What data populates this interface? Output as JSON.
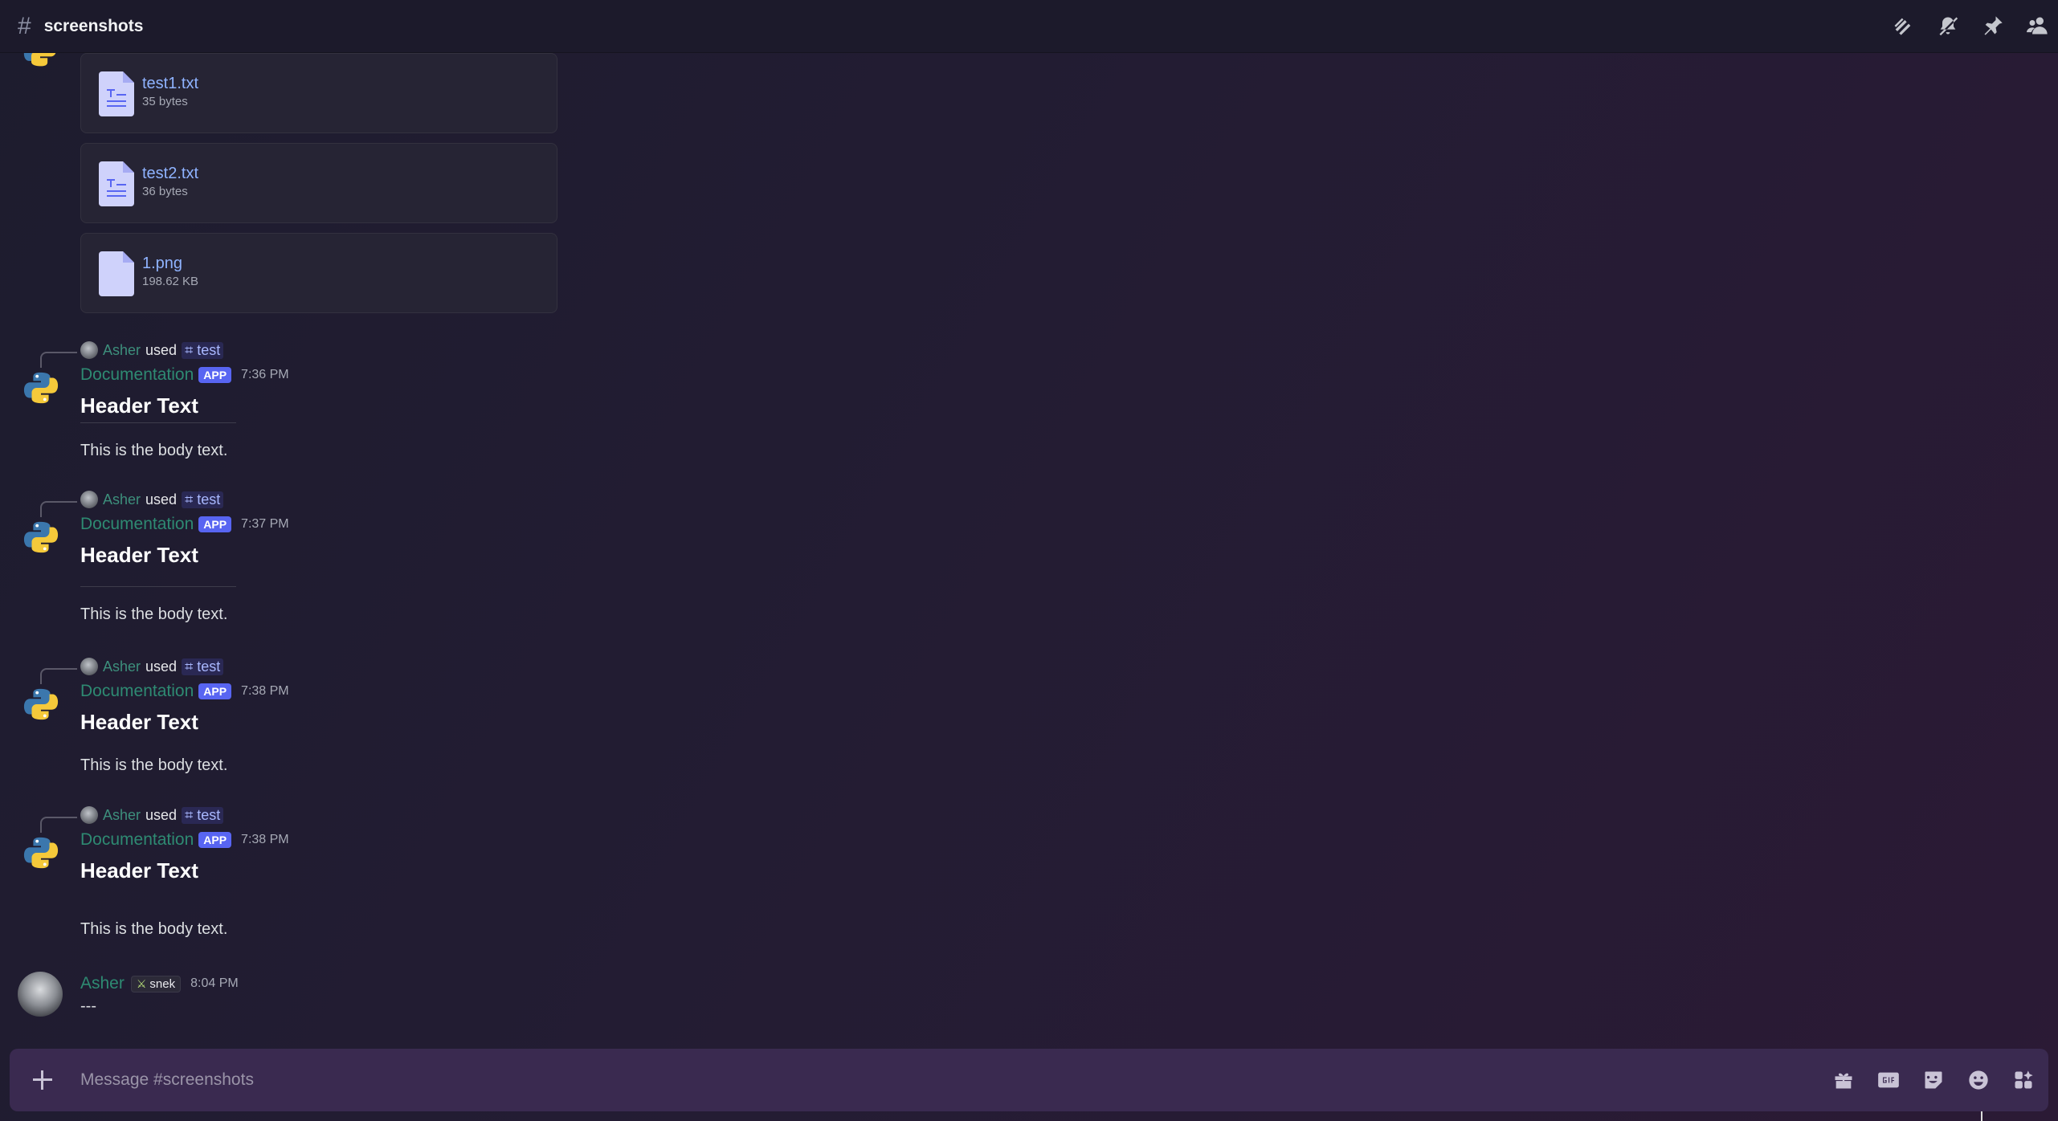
{
  "header": {
    "hash_symbol": "#",
    "channel_name": "screenshots"
  },
  "top_icons": [
    "threads-icon",
    "notification-mute-icon",
    "pin-icon",
    "members-icon"
  ],
  "attachments": [
    {
      "name": "test1.txt",
      "size": "35 bytes",
      "icon": "text-file-icon"
    },
    {
      "name": "test2.txt",
      "size": "36 bytes",
      "icon": "text-file-icon"
    },
    {
      "name": "1.png",
      "size": "198.62 KB",
      "icon": "file-icon"
    }
  ],
  "bot_messages": [
    {
      "reply_user": "Asher",
      "reply_used": "used",
      "command": "test",
      "bot_name": "Documentation",
      "badge": "APP",
      "time": "7:36 PM",
      "header": "Header Text",
      "body": "This is the body text."
    },
    {
      "reply_user": "Asher",
      "reply_used": "used",
      "command": "test",
      "bot_name": "Documentation",
      "badge": "APP",
      "time": "7:37 PM",
      "header": "Header Text",
      "body": "This is the body text."
    },
    {
      "reply_user": "Asher",
      "reply_used": "used",
      "command": "test",
      "bot_name": "Documentation",
      "badge": "APP",
      "time": "7:38 PM",
      "header": "Header Text",
      "body": "This is the body text."
    },
    {
      "reply_user": "Asher",
      "reply_used": "used",
      "command": "test",
      "bot_name": "Documentation",
      "badge": "APP",
      "time": "7:38 PM",
      "header": "Header Text",
      "body": "This is the body text."
    }
  ],
  "user_message": {
    "name": "Asher",
    "tag": "snek",
    "time": "8:04 PM",
    "body": "---"
  },
  "composer": {
    "placeholder": "Message #screenshots",
    "icons": [
      "gift-icon",
      "gif-icon",
      "sticker-icon",
      "emoji-icon",
      "apps-icon"
    ]
  },
  "colors": {
    "accent": "#5865f2",
    "username": "#2e8a72",
    "link": "#8fb3ff"
  }
}
